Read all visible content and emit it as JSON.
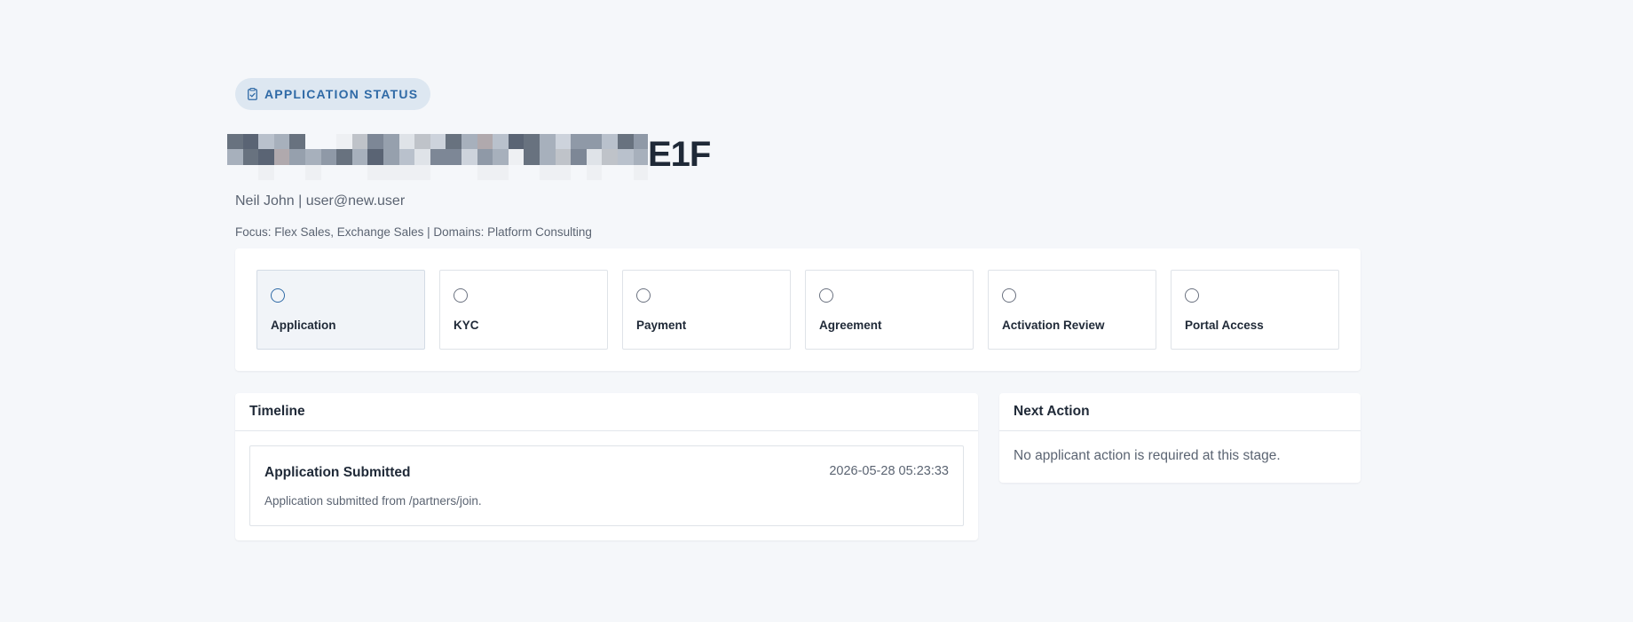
{
  "header": {
    "badge_label": "APPLICATION STATUS",
    "title_suffix": "E1F",
    "subline": "Neil John | user@new.user",
    "focus": "Focus: Flex Sales, Exchange Sales | Domains: Platform Consulting"
  },
  "steps": [
    {
      "label": "Application",
      "active": true
    },
    {
      "label": "KYC",
      "active": false
    },
    {
      "label": "Payment",
      "active": false
    },
    {
      "label": "Agreement",
      "active": false
    },
    {
      "label": "Activation Review",
      "active": false
    },
    {
      "label": "Portal Access",
      "active": false
    }
  ],
  "timeline": {
    "title": "Timeline",
    "events": [
      {
        "title": "Application Submitted",
        "time": "2026-05-28 05:23:33",
        "description": "Application submitted from /partners/join."
      }
    ]
  },
  "next_action": {
    "title": "Next Action",
    "text": "No applicant action is required at this stage."
  },
  "colors": {
    "background": "#f5f7fa",
    "accent": "#2f6aa6",
    "badge_bg": "#dde7f1"
  },
  "icons": {
    "badge_icon": "clipboard-check-icon"
  }
}
